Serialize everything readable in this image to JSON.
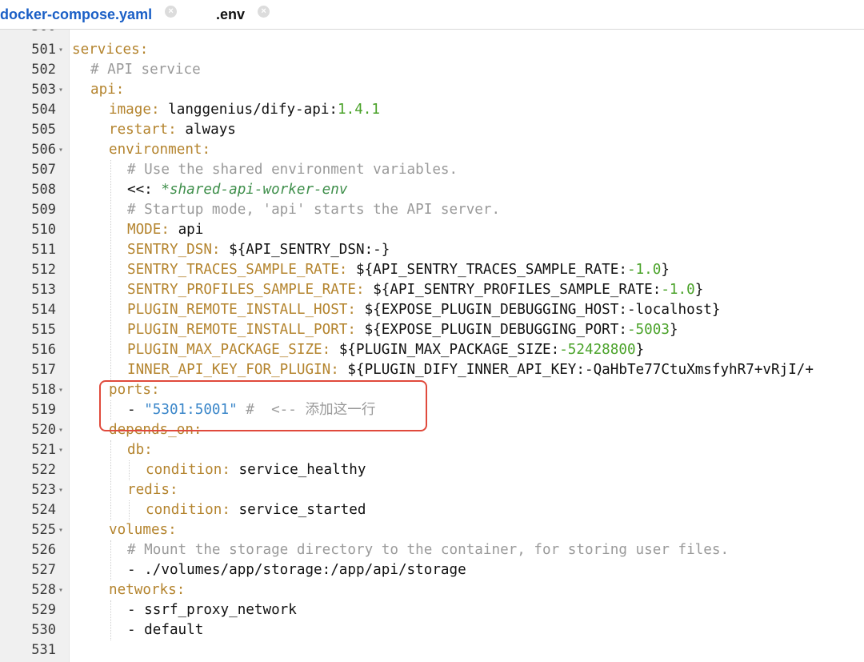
{
  "tabs": [
    {
      "label": "docker-compose.yaml",
      "active": true,
      "close_icon": "×"
    },
    {
      "label": ".env",
      "active": false,
      "close_icon": "×"
    }
  ],
  "editor": {
    "partial_top_line": "500",
    "fold_icon": "▾",
    "lines": [
      {
        "n": "501",
        "fold": true,
        "indent": 0,
        "parts": [
          [
            "k",
            "services:"
          ]
        ]
      },
      {
        "n": "502",
        "fold": false,
        "indent": 1,
        "parts": [
          [
            "c",
            "# API service"
          ]
        ]
      },
      {
        "n": "503",
        "fold": true,
        "indent": 1,
        "parts": [
          [
            "k",
            "api:"
          ]
        ]
      },
      {
        "n": "504",
        "fold": false,
        "indent": 2,
        "parts": [
          [
            "k",
            "image: "
          ],
          [
            "t",
            "langgenius/dify-api:"
          ],
          [
            "n",
            "1.4.1"
          ]
        ]
      },
      {
        "n": "505",
        "fold": false,
        "indent": 2,
        "parts": [
          [
            "k",
            "restart: "
          ],
          [
            "t",
            "always"
          ]
        ]
      },
      {
        "n": "506",
        "fold": true,
        "indent": 2,
        "parts": [
          [
            "k",
            "environment:"
          ]
        ]
      },
      {
        "n": "507",
        "fold": false,
        "indent": 3,
        "parts": [
          [
            "c",
            "# Use the shared environment variables."
          ]
        ]
      },
      {
        "n": "508",
        "fold": false,
        "indent": 3,
        "parts": [
          [
            "t",
            "<<: "
          ],
          [
            "a",
            "*shared-api-worker-env"
          ]
        ]
      },
      {
        "n": "509",
        "fold": false,
        "indent": 3,
        "parts": [
          [
            "c",
            "# Startup mode, 'api' starts the API server."
          ]
        ]
      },
      {
        "n": "510",
        "fold": false,
        "indent": 3,
        "parts": [
          [
            "k",
            "MODE: "
          ],
          [
            "t",
            "api"
          ]
        ]
      },
      {
        "n": "511",
        "fold": false,
        "indent": 3,
        "parts": [
          [
            "k",
            "SENTRY_DSN: "
          ],
          [
            "t",
            "${API_SENTRY_DSN:-}"
          ]
        ]
      },
      {
        "n": "512",
        "fold": false,
        "indent": 3,
        "parts": [
          [
            "k",
            "SENTRY_TRACES_SAMPLE_RATE: "
          ],
          [
            "t",
            "${API_SENTRY_TRACES_SAMPLE_RATE:"
          ],
          [
            "n",
            "-1.0"
          ],
          [
            "t",
            "}"
          ]
        ]
      },
      {
        "n": "513",
        "fold": false,
        "indent": 3,
        "parts": [
          [
            "k",
            "SENTRY_PROFILES_SAMPLE_RATE: "
          ],
          [
            "t",
            "${API_SENTRY_PROFILES_SAMPLE_RATE:"
          ],
          [
            "n",
            "-1.0"
          ],
          [
            "t",
            "}"
          ]
        ]
      },
      {
        "n": "514",
        "fold": false,
        "indent": 3,
        "parts": [
          [
            "k",
            "PLUGIN_REMOTE_INSTALL_HOST: "
          ],
          [
            "t",
            "${EXPOSE_PLUGIN_DEBUGGING_HOST:-localhost}"
          ]
        ]
      },
      {
        "n": "515",
        "fold": false,
        "indent": 3,
        "parts": [
          [
            "k",
            "PLUGIN_REMOTE_INSTALL_PORT: "
          ],
          [
            "t",
            "${EXPOSE_PLUGIN_DEBUGGING_PORT:"
          ],
          [
            "n",
            "-5003"
          ],
          [
            "t",
            "}"
          ]
        ]
      },
      {
        "n": "516",
        "fold": false,
        "indent": 3,
        "parts": [
          [
            "k",
            "PLUGIN_MAX_PACKAGE_SIZE: "
          ],
          [
            "t",
            "${PLUGIN_MAX_PACKAGE_SIZE:"
          ],
          [
            "n",
            "-52428800"
          ],
          [
            "t",
            "}"
          ]
        ]
      },
      {
        "n": "517",
        "fold": false,
        "indent": 3,
        "parts": [
          [
            "k",
            "INNER_API_KEY_FOR_PLUGIN: "
          ],
          [
            "t",
            "${PLUGIN_DIFY_INNER_API_KEY:-QaHbTe77CtuXmsfyhR7+vRjI/+"
          ]
        ]
      },
      {
        "n": "518",
        "fold": true,
        "indent": 2,
        "parts": [
          [
            "k",
            "ports:"
          ]
        ]
      },
      {
        "n": "519",
        "fold": false,
        "indent": 3,
        "parts": [
          [
            "t",
            "- "
          ],
          [
            "s",
            "\"5301:5001\""
          ],
          [
            "c",
            " #  <-- 添加这一行"
          ]
        ]
      },
      {
        "n": "520",
        "fold": true,
        "indent": 2,
        "parts": [
          [
            "k",
            "depends_on:"
          ]
        ]
      },
      {
        "n": "521",
        "fold": true,
        "indent": 3,
        "parts": [
          [
            "k",
            "db:"
          ]
        ]
      },
      {
        "n": "522",
        "fold": false,
        "indent": 4,
        "parts": [
          [
            "k",
            "condition: "
          ],
          [
            "t",
            "service_healthy"
          ]
        ]
      },
      {
        "n": "523",
        "fold": true,
        "indent": 3,
        "parts": [
          [
            "k",
            "redis:"
          ]
        ]
      },
      {
        "n": "524",
        "fold": false,
        "indent": 4,
        "parts": [
          [
            "k",
            "condition: "
          ],
          [
            "t",
            "service_started"
          ]
        ]
      },
      {
        "n": "525",
        "fold": true,
        "indent": 2,
        "parts": [
          [
            "k",
            "volumes:"
          ]
        ]
      },
      {
        "n": "526",
        "fold": false,
        "indent": 3,
        "parts": [
          [
            "c",
            "# Mount the storage directory to the container, for storing user files."
          ]
        ]
      },
      {
        "n": "527",
        "fold": false,
        "indent": 3,
        "parts": [
          [
            "t",
            "- ./volumes/app/storage:/app/api/storage"
          ]
        ]
      },
      {
        "n": "528",
        "fold": true,
        "indent": 2,
        "parts": [
          [
            "k",
            "networks:"
          ]
        ]
      },
      {
        "n": "529",
        "fold": false,
        "indent": 3,
        "parts": [
          [
            "t",
            "- ssrf_proxy_network"
          ]
        ]
      },
      {
        "n": "530",
        "fold": false,
        "indent": 3,
        "parts": [
          [
            "t",
            "- default"
          ]
        ]
      },
      {
        "n": "531",
        "fold": false,
        "indent": 0,
        "parts": []
      }
    ]
  },
  "colors": {
    "key": "#b4842e",
    "comment": "#9a9a9a",
    "string": "#3a86c9",
    "number": "#4aa229",
    "alias": "#3f8f4b",
    "highlight_border": "#e04a3c",
    "active_tab": "#1a5fc6"
  }
}
